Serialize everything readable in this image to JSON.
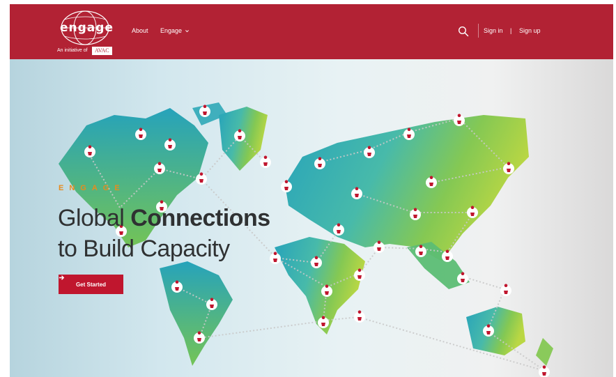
{
  "header": {
    "logo_text": "engage",
    "initiative_label": "An initiative of",
    "initiative_org": "AVAC",
    "nav": [
      {
        "label": "About"
      },
      {
        "label": "Engage",
        "icon": "chevron-down-icon"
      }
    ],
    "search_icon": "search-icon",
    "sign_in_label": "Sign in",
    "separator": "|",
    "sign_up_label": "Sign up"
  },
  "hero": {
    "eyebrow": "ENGAGE",
    "headline_line1_regular": "Global ",
    "headline_line1_bold": "Connections",
    "headline_line2": "to Build Capacity",
    "cta_label": "Get Started",
    "cta_icon": "arrow-right-icon",
    "map_description_icons": "location-pin-icon"
  },
  "colors": {
    "brand_red": "#b22234",
    "cta_red": "#c0162e",
    "accent_orange": "#e88b1e",
    "headline_text": "#2f3132",
    "map_teal": "#1fa3b8",
    "map_green": "#8cc63f"
  }
}
